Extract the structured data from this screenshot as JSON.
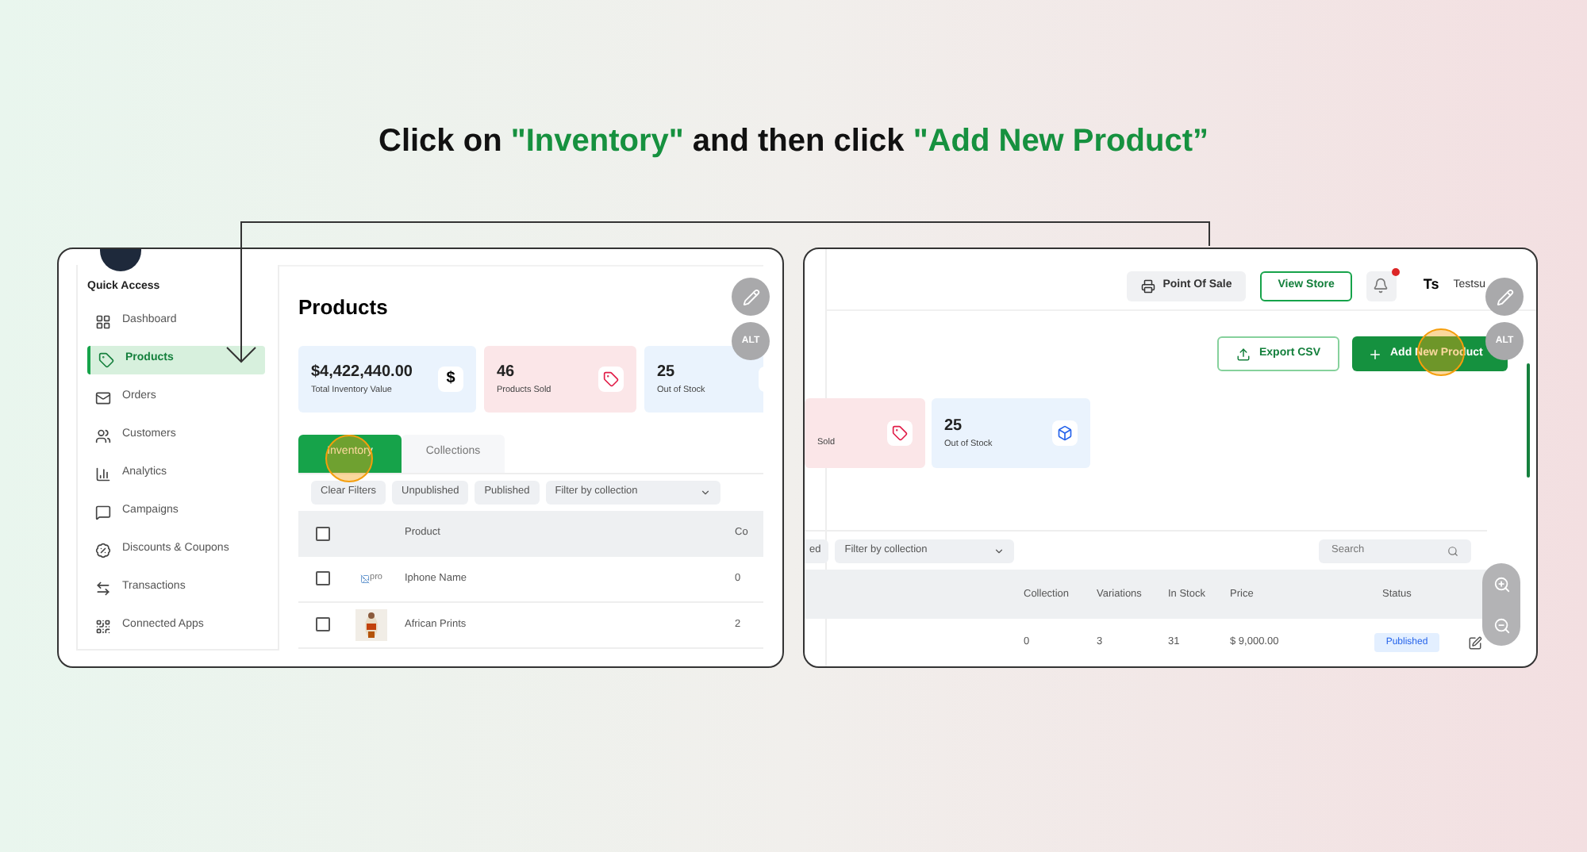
{
  "instruction": [
    {
      "text": "Click on ",
      "highlight": false
    },
    {
      "text": "\"Inventory\"",
      "highlight": true
    },
    {
      "text": " and then click ",
      "highlight": false
    },
    {
      "text": "\"Add New Product”",
      "highlight": true
    }
  ],
  "step_1": {
    "sidebar": {
      "title": "Quick Access",
      "items": [
        {
          "label": "Dashboard",
          "selected": false
        },
        {
          "label": "Products",
          "selected": true
        },
        {
          "label": "Orders",
          "selected": false
        },
        {
          "label": "Customers",
          "selected": false
        },
        {
          "label": "Analytics",
          "selected": false
        },
        {
          "label": "Campaigns",
          "selected": false
        },
        {
          "label": "Discounts & Coupons",
          "selected": false
        },
        {
          "label": "Transactions",
          "selected": false
        },
        {
          "label": "Connected Apps",
          "selected": false
        }
      ]
    },
    "page_title": "Products",
    "stats": [
      {
        "value": "$4,422,440.00",
        "label": "Total Inventory Value",
        "kind": "dollar",
        "symbol": "$"
      },
      {
        "value": "46",
        "label": "Products Sold",
        "kind": "tag"
      },
      {
        "value": "25",
        "label": "Out of Stock",
        "kind": "box"
      }
    ],
    "tabs": [
      {
        "label": "Inventory",
        "selected": true
      },
      {
        "label": "Collections",
        "selected": false
      }
    ],
    "filters": [
      "Clear Filters",
      "Unpublished",
      "Published"
    ],
    "filter_dropdown": "Filter by collection",
    "columns": [
      "Product",
      "Co"
    ],
    "header_checked": false,
    "rows": [
      {
        "checked": false,
        "kind": "broken-image",
        "image_alt": "pro",
        "product": "Iphone Name",
        "column_2": "0"
      },
      {
        "checked": false,
        "product": "African Prints",
        "column_2": "2"
      }
    ],
    "alt_button": "ALT"
  },
  "step_2": {
    "topbar": {
      "point_of_sale": "Point Of Sale",
      "view_store": "View Store",
      "unread": true,
      "logo": "Ts",
      "user": "Testsu"
    },
    "alt_button": "ALT",
    "actions": {
      "export": "Export CSV",
      "add": "Add New Product"
    },
    "stats": [
      {
        "label": "Sold",
        "kind": "tag"
      },
      {
        "value": "25",
        "label": "Out of Stock",
        "kind": "box"
      }
    ],
    "filter_chip": "ed",
    "filter_dropdown": "Filter by collection",
    "search_placeholder": "Search",
    "columns": [
      "Collection",
      "Variations",
      "In Stock",
      "Price",
      "Status"
    ],
    "rows": [
      {
        "collection": "0",
        "variations": "3",
        "in_stock": "31",
        "price": "$ 9,000.00",
        "status": "Published"
      }
    ]
  }
}
